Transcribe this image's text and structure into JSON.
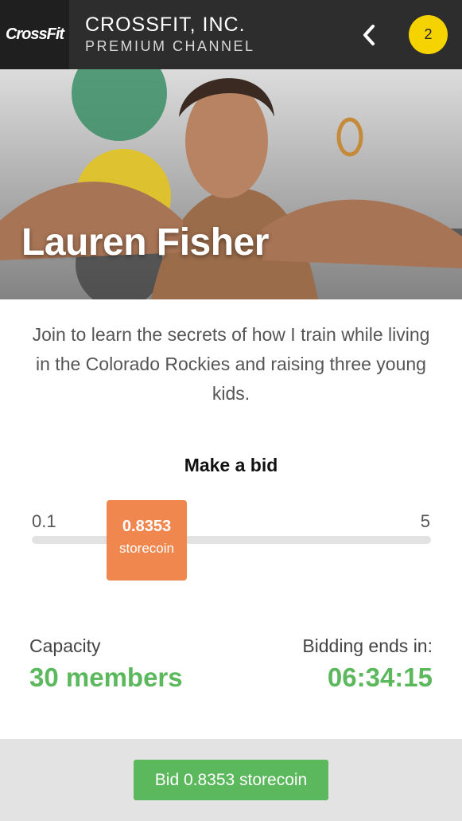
{
  "header": {
    "logo_text": "CrossFit",
    "title": "CROSSFIT, INC.",
    "subtitle": "PREMIUM CHANNEL",
    "back_icon": "chevron-left-icon",
    "badge_count": "2",
    "badge_color": "#f5d300"
  },
  "hero": {
    "name": "Lauren Fisher"
  },
  "description": "Join to learn the secrets of how I train while living in the Colorado Rockies and raising three young kids.",
  "bid": {
    "title": "Make a bid",
    "min_label": "0.1",
    "max_label": "5",
    "current_value": "0.8353",
    "unit": "storecoin",
    "thumb_color": "#f0874f"
  },
  "stats": {
    "capacity_label": "Capacity",
    "capacity_value": "30 members",
    "ends_label": "Bidding ends in:",
    "ends_value": "06:34:15",
    "accent_color": "#5cb85c"
  },
  "footer": {
    "button_label": "Bid 0.8353 storecoin"
  }
}
